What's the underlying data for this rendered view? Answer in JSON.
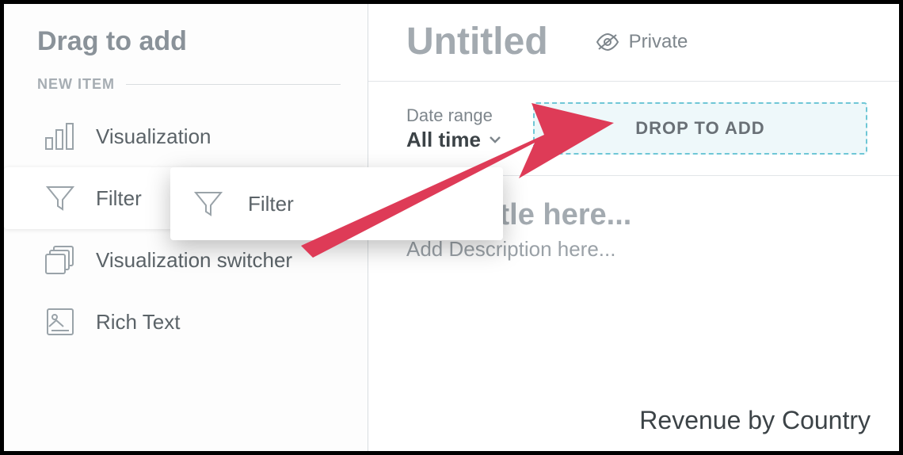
{
  "sidebar": {
    "title": "Drag to add",
    "section_label": "NEW ITEM",
    "items": [
      {
        "label": "Visualization",
        "icon": "bar-chart-icon"
      },
      {
        "label": "Filter",
        "icon": "funnel-icon"
      },
      {
        "label": "Visualization switcher",
        "icon": "stack-icon"
      },
      {
        "label": "Rich Text",
        "icon": "image-text-icon"
      }
    ]
  },
  "header": {
    "title": "Untitled",
    "privacy_label": "Private"
  },
  "controls": {
    "date_range_label": "Date range",
    "date_range_value": "All time",
    "dropzone_label": "DROP TO ADD"
  },
  "content": {
    "title_placeholder": "Add Title here...",
    "description_placeholder": "Add Description here...",
    "chart_title": "Revenue by Country"
  },
  "drag_ghost": {
    "label": "Filter"
  },
  "colors": {
    "accent_arrow": "#de3b57",
    "dropzone_border": "#6fc7d6",
    "dropzone_bg": "#eef8fa"
  }
}
